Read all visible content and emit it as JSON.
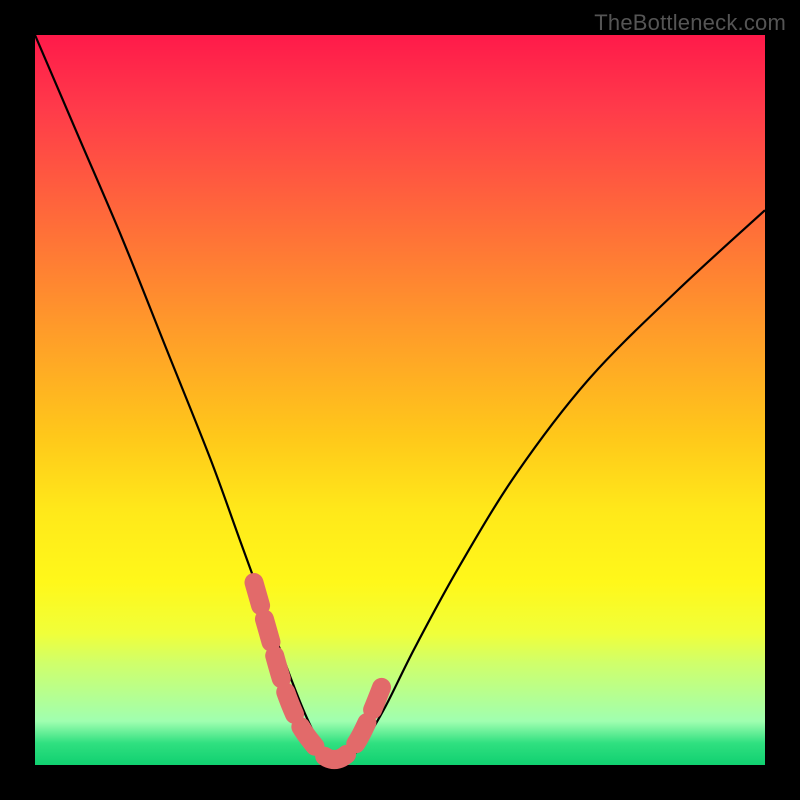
{
  "watermark": "TheBottleneck.com",
  "chart_data": {
    "type": "line",
    "title": "",
    "xlabel": "",
    "ylabel": "",
    "xlim": [
      0,
      100
    ],
    "ylim": [
      0,
      100
    ],
    "series": [
      {
        "name": "bottleneck-curve",
        "x": [
          0,
          6,
          12,
          18,
          24,
          28,
          32,
          35,
          37,
          39,
          41,
          43,
          45,
          48,
          52,
          58,
          66,
          76,
          88,
          100
        ],
        "values": [
          100,
          86,
          72,
          57,
          42,
          31,
          20,
          12,
          7,
          3,
          1,
          1,
          3,
          8,
          16,
          27,
          40,
          53,
          65,
          76
        ]
      }
    ],
    "markers": {
      "name": "optimal-range",
      "color": "#e26a6a",
      "x": [
        30,
        32,
        34,
        36,
        38,
        40,
        42,
        44,
        46,
        48
      ],
      "values": [
        25,
        18,
        11,
        6,
        3,
        1,
        1,
        3,
        7,
        12
      ]
    },
    "gradient_stops": [
      {
        "pos": 0,
        "color": "#ff1a4a"
      },
      {
        "pos": 25,
        "color": "#ff6a3a"
      },
      {
        "pos": 55,
        "color": "#ffc81a"
      },
      {
        "pos": 80,
        "color": "#f0ff3a"
      },
      {
        "pos": 100,
        "color": "#10d070"
      }
    ]
  }
}
